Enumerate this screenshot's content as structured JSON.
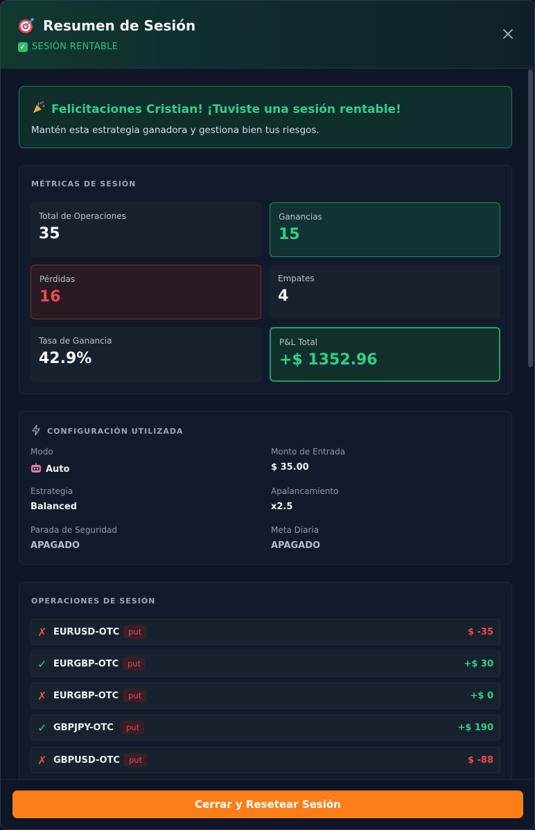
{
  "header": {
    "title": "Resumen de Sesión",
    "status": "SESIÓN RENTABLE",
    "icons": {
      "title": "target-icon",
      "status": "check-box-icon",
      "close": "close-icon"
    }
  },
  "congrats": {
    "title": "Felicitaciones Cristian! ¡Tuviste una sesión rentable!",
    "message": "Mantén esta estrategia ganadora y gestiona bien tus riesgos.",
    "icon": "party-popper-icon"
  },
  "metrics": {
    "title": "MÉTRICAS DE SESIÓN",
    "items": [
      {
        "label": "Total de Operaciones",
        "value": "35"
      },
      {
        "label": "Ganancias",
        "value": "15"
      },
      {
        "label": "Pérdidas",
        "value": "16"
      },
      {
        "label": "Empates",
        "value": "4"
      },
      {
        "label": "Tasa de Ganancia",
        "value": "42.9%"
      },
      {
        "label": "P&L Total",
        "value": "+$ 1352.96"
      }
    ]
  },
  "config": {
    "title": "CONFIGURACIÓN UTILIZADA",
    "icon": "lightning-icon",
    "items": [
      {
        "label": "Modo",
        "value": "Auto",
        "icon": "robot-icon"
      },
      {
        "label": "Monto de Entrada",
        "value": "$ 35.00"
      },
      {
        "label": "Estrategia",
        "value": "Balanced"
      },
      {
        "label": "Apalancamiento",
        "value": "x2.5"
      },
      {
        "label": "Parada de Seguridad",
        "value": "APAGADO"
      },
      {
        "label": "Meta Diaria",
        "value": "APAGADO"
      }
    ]
  },
  "operations": {
    "title": "OPERACIONES DE SESIÓN",
    "rows": [
      {
        "result": "loss",
        "mark": "✗",
        "pair": "EURUSD-OTC",
        "direction": "put",
        "amount": "$ -35"
      },
      {
        "result": "win",
        "mark": "✓",
        "pair": "EURGBP-OTC",
        "direction": "put",
        "amount": "+$ 30"
      },
      {
        "result": "loss",
        "mark": "✗",
        "pair": "EURGBP-OTC",
        "direction": "put",
        "amount": "+$ 0"
      },
      {
        "result": "win",
        "mark": "✓",
        "pair": "GBPJPY-OTC",
        "direction": "put",
        "amount": "+$ 190"
      },
      {
        "result": "loss",
        "mark": "✗",
        "pair": "GBPUSD-OTC",
        "direction": "put",
        "amount": "$ -88"
      }
    ]
  },
  "footer": {
    "button_label": "Cerrar y Resetear Sesión"
  },
  "colors": {
    "accent_orange": "#fb7e1a",
    "win_green": "#2fcf8a",
    "loss_red": "#ef4a4a",
    "background": "#0f1726"
  }
}
